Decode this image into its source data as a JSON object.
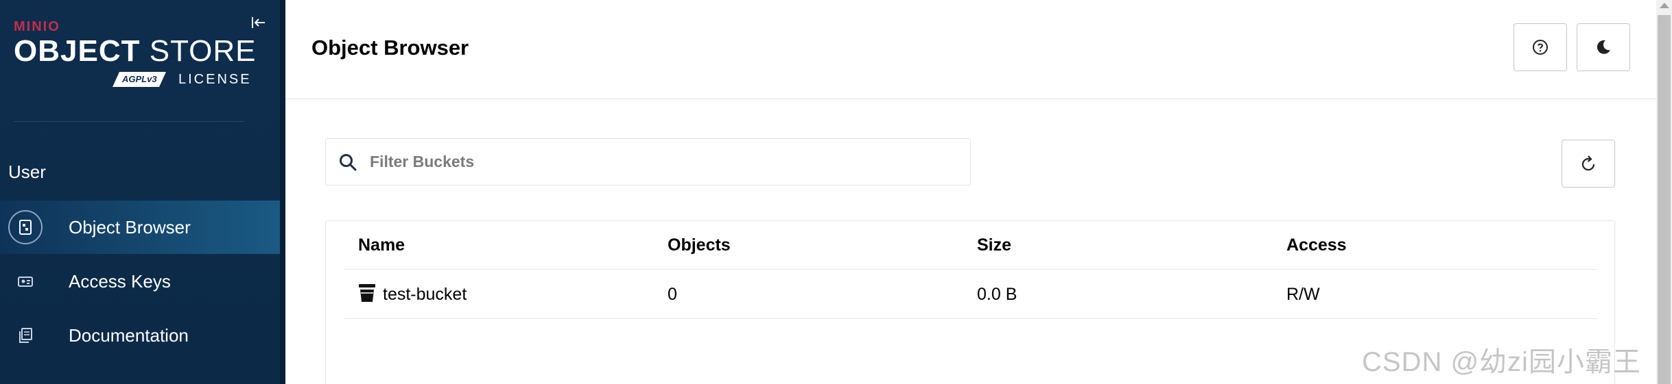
{
  "sidebar": {
    "brand": {
      "small": "MINIO",
      "title_bold": "OBJECT",
      "title_light": "STORE",
      "license": "LICENSE",
      "agpl_text": "AGPLv3"
    },
    "section_label": "User",
    "items": [
      {
        "label": "Object Browser",
        "icon": "object-browser-icon",
        "active": true
      },
      {
        "label": "Access Keys",
        "icon": "access-keys-icon",
        "active": false
      },
      {
        "label": "Documentation",
        "icon": "documentation-icon",
        "active": false
      }
    ]
  },
  "header": {
    "title": "Object Browser"
  },
  "search": {
    "placeholder": "Filter Buckets",
    "value": ""
  },
  "table": {
    "columns": [
      "Name",
      "Objects",
      "Size",
      "Access"
    ],
    "rows": [
      {
        "name": "test-bucket",
        "objects": "0",
        "size": "0.0 B",
        "access": "R/W"
      }
    ]
  },
  "watermark": "CSDN @幼zi园小霸王",
  "colors": {
    "sidebar_bg": "#0e2d4d",
    "active_item": "#1a5a83",
    "brand_red": "#c72c48"
  }
}
